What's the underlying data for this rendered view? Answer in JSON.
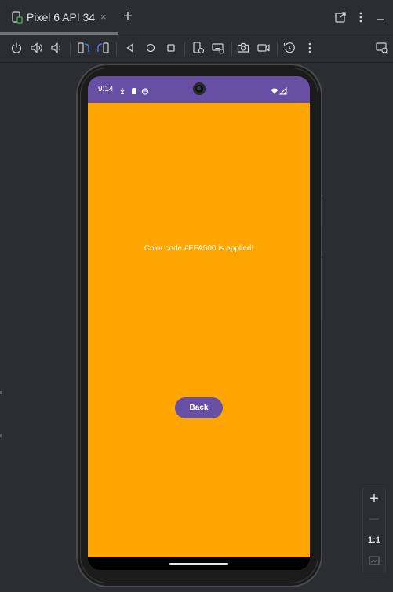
{
  "tab": {
    "title": "Pixel 6 API 34",
    "close_glyph": "×",
    "add_glyph": "+"
  },
  "top_right_icons": [
    "open-in-window-icon",
    "more-vertical-icon"
  ],
  "toolbar": {
    "icons": [
      "power-icon",
      "volume-up-icon",
      "volume-down-icon",
      "rotate-left-icon",
      "rotate-right-icon",
      "back-icon",
      "home-icon",
      "overview-icon",
      "device-settings-icon",
      "keyboard-icon",
      "camera-icon",
      "screen-record-icon",
      "snapshot-history-icon",
      "more-vertical-icon"
    ],
    "right_icon": "device-mirroring-icon"
  },
  "device": {
    "status_bar": {
      "time": "9:14",
      "color": "#6750a4"
    },
    "screen": {
      "background": "#ffa500",
      "message": "Color code #FFA500 is applied!",
      "button_label": "Back",
      "button_color": "#6750a4"
    }
  },
  "zoom_panel": {
    "zoom_in": "+",
    "zoom_out": "—",
    "actual_size": "1:1",
    "fit_icon": "fit-screen-icon"
  }
}
